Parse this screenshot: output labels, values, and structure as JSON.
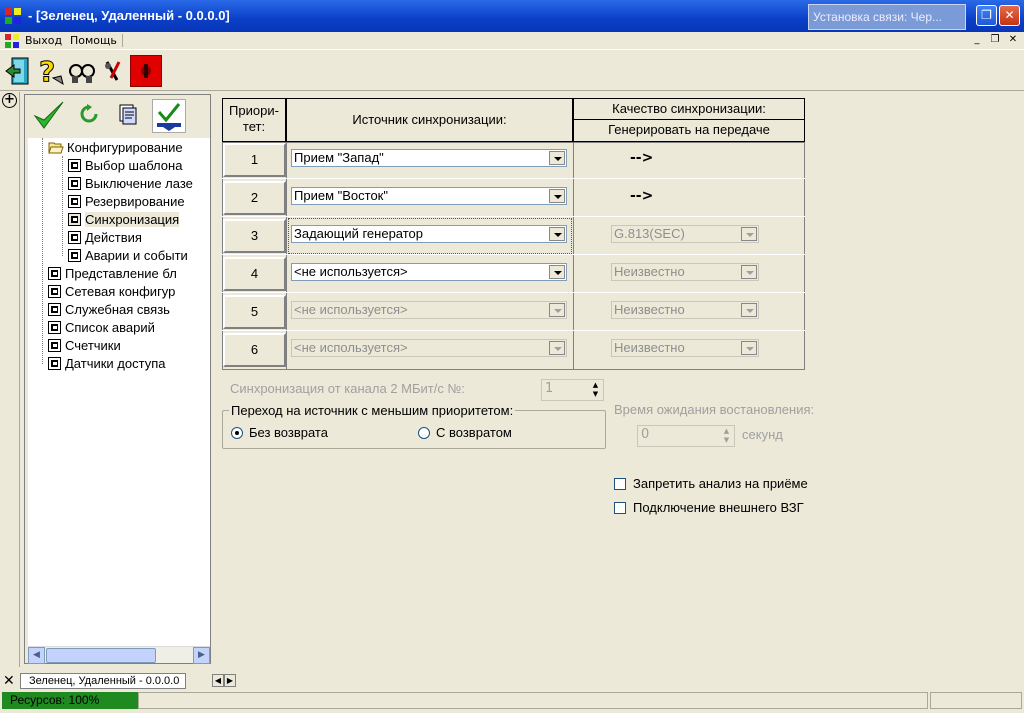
{
  "window": {
    "title": "- [Зеленец, Удаленный - 0.0.0.0]",
    "popup_title": "Установка связи: Чер..."
  },
  "menu": {
    "items": [
      "Выход",
      "Помощь"
    ]
  },
  "tree": {
    "items": [
      {
        "label": "Конфигурирование",
        "level": 1,
        "icon": "folder-open-icon"
      },
      {
        "label": "Выбор шаблона",
        "level": 2,
        "icon": "shortcut-icon"
      },
      {
        "label": "Выключение лазе",
        "level": 2,
        "icon": "shortcut-icon"
      },
      {
        "label": "Резервирование",
        "level": 2,
        "icon": "shortcut-icon"
      },
      {
        "label": "Синхронизация",
        "level": 2,
        "icon": "shortcut-icon",
        "selected": true
      },
      {
        "label": "Действия",
        "level": 2,
        "icon": "shortcut-icon"
      },
      {
        "label": "Аварии и событи",
        "level": 2,
        "icon": "shortcut-icon"
      },
      {
        "label": "Представление бл",
        "level": 1,
        "icon": "shortcut-icon"
      },
      {
        "label": "Сетевая конфигур",
        "level": 1,
        "icon": "shortcut-icon"
      },
      {
        "label": "Служебная связь",
        "level": 1,
        "icon": "shortcut-icon"
      },
      {
        "label": "Список аварий",
        "level": 1,
        "icon": "shortcut-icon"
      },
      {
        "label": "Счетчики",
        "level": 1,
        "icon": "shortcut-icon"
      },
      {
        "label": "Датчики доступа",
        "level": 1,
        "icon": "shortcut-icon"
      }
    ]
  },
  "grid": {
    "col_priority": [
      "Приори-",
      "тет:"
    ],
    "col_source": "Источник синхронизации:",
    "col_quality_1": "Качество синхронизации:",
    "col_quality_2": "Генерировать на передаче",
    "rows": [
      {
        "num": "1",
        "source": "Прием \"Запад\"",
        "quality": "-->"
      },
      {
        "num": "2",
        "source": "Прием \"Восток\"",
        "quality": "-->"
      },
      {
        "num": "3",
        "source": "Задающий генератор",
        "quality": "G.813(SEC)"
      },
      {
        "num": "4",
        "source": "<не используется>",
        "quality": "Неизвестно"
      },
      {
        "num": "5",
        "source": "<не используется>",
        "quality": "Неизвестно"
      },
      {
        "num": "6",
        "source": "<не используется>",
        "quality": "Неизвестно"
      }
    ]
  },
  "form": {
    "sync_channel_label": "Синхронизация от канала 2 МБит/с №:",
    "sync_channel_value": "1",
    "group_title": "Переход на источник с меньшим приоритетом:",
    "radio_no_return": "Без возврата",
    "radio_return": "С возвратом",
    "wait_label": "Время ожидания востановления:",
    "wait_value": "0",
    "wait_unit": "секунд",
    "check_disable_analysis": "Запретить анализ на приёме",
    "check_external": "Подключение внешнего ВЗГ"
  },
  "tabs": {
    "active": "Зеленец, Удаленный - 0.0.0.0"
  },
  "status": {
    "resources": "Ресурсов: 100%"
  }
}
